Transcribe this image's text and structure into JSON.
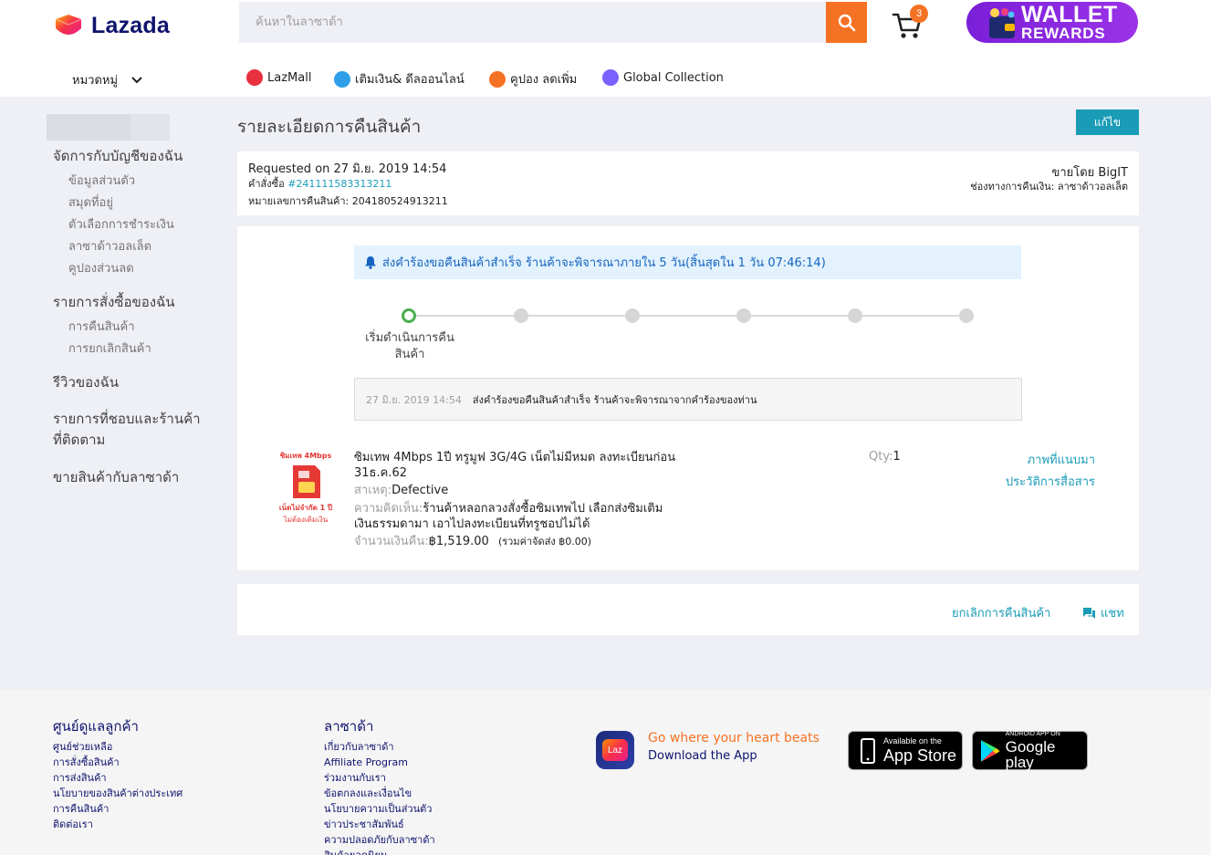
{
  "header": {
    "logo_text": "Lazada",
    "search_placeholder": "ค้นหาในลาซาด้า",
    "cart_count": "3",
    "wallet_line1": "WALLET",
    "wallet_line2": "REWARDS",
    "categories_label": "หมวดหมู่",
    "nav": [
      {
        "label": "LazMall",
        "icon": "lazmall-icon",
        "color": "#e8303f"
      },
      {
        "label": "เติมเงิน& ดีลออนไลน์",
        "icon": "topup-icon",
        "color": "#2e9fe8"
      },
      {
        "label": "คูปอง ลดเพิ่ม",
        "icon": "voucher-icon",
        "color": "#f57224"
      },
      {
        "label": "Global Collection",
        "icon": "global-icon",
        "color": "#7b61ff"
      }
    ]
  },
  "sidebar": {
    "account": {
      "title": "จัดการกับบัญชีของฉัน",
      "items": [
        "ข้อมูลส่วนตัว",
        "สมุดที่อยู่",
        "ตัวเลือกการชำระเงิน",
        "ลาซาด้าวอลเล็ต",
        "คูปองส่วนลด"
      ]
    },
    "orders": {
      "title": "รายการสั่งซื้อของฉัน",
      "items": [
        "การคืนสินค้า",
        "การยกเลิกสินค้า"
      ]
    },
    "reviews": "รีวิวของฉัน",
    "wishlist_line1": "รายการที่ชอบและร้านค้า",
    "wishlist_line2": "ที่ติดตาม",
    "sell": "ขายสินค้ากับลาซาด้า"
  },
  "main": {
    "title": "รายละเอียดการคืนสินค้า",
    "edit_label": "แก้ไข",
    "info": {
      "requested": "Requested on 27 มิ.ย. 2019 14:54",
      "order_label": "คำสั่งซื้อ ",
      "order_number": "#241111583313211",
      "return_number": "หมายเลขการคืนสินค้า: 204180524913211",
      "seller": "ขายโดย BigIT",
      "refund_channel": "ช่องทางการคืนเงิน: ลาซาด้าวอลเล็ต"
    },
    "notice": "ส่งคำร้องขอคืนสินค้าสำเร็จ ร้านค้าจะพิจารณาภายใน 5 วัน(สิ้นสุดใน 1 วัน 07:46:14)",
    "timeline_label": "เริ่มดำเนินการคืนสินค้า",
    "log": {
      "time": "27 มิ.ย. 2019 14:54",
      "text": "ส่งคำร้องขอคืนสินค้าสำเร็จ ร้านค้าจะพิจารณาจากคำร้องของท่าน"
    },
    "product": {
      "name_line1": "ซิมเทพ 4Mbps 1ปี ทรูมูฟ 3G/4G เน็ตไม่มีหมด ลงทะเบียนก่อน",
      "name_line2": "31ธ.ค.62",
      "reason_label": "สาเหตุ:",
      "reason_value": "Defective",
      "comment_label": "ความคิดเห็น:",
      "comment_line1": "ร้านค้าหลอกลวงสั่งซื้อซิมเทพไป เลือกส่งซิมเติม",
      "comment_line2": "เงินธรรมดามา เอาไปลงทะเบียนที่ทรูชอปไม่ได้",
      "amount_label": "จำนวนเงินคืน:",
      "amount_value": "฿1,519.00",
      "shipping_note": "(รวมค่าจัดส่ง ฿0.00)",
      "qty_label": "Qty:",
      "qty_value": "1",
      "image_caption_top": "ซิมเทพ 4Mbps",
      "image_caption_bottom1": "เน็ตไม่จำกัด 1 ปี",
      "image_caption_bottom2": "ไม่ต้องเติมเงิน",
      "link_photos": "ภาพที่แนบมา",
      "link_history": "ประวัติการสื่อสาร"
    },
    "actions": {
      "cancel_return": "ยกเลิกการคืนสินค้า",
      "chat": "แชท"
    }
  },
  "footer": {
    "care_title": "ศูนย์ดูแลลูกค้า",
    "care_items": [
      "ศูนย์ช่วยเหลือ",
      "การสั่งซื้อสินค้า",
      "การส่งสินค้า",
      "นโยบายของสินค้าต่างประเทศ",
      "การคืนสินค้า",
      "ติดต่อเรา"
    ],
    "lazada_title": "ลาซาด้า",
    "lazada_items": [
      "เกี่ยวกับลาซาด้า",
      "Affiliate Program",
      "ร่วมงานกับเรา",
      "ข้อตกลงและเงื่อนไข",
      "นโยบายความเป็นส่วนตัว",
      "ข่าวประชาสัมพันธ์",
      "ความปลอดภัยกับลาซาด้า",
      "สินค้ายอดนิยม"
    ],
    "app_tagline": "Go where your heart beats",
    "app_download": "Download the App",
    "app_icon_text": "Laz",
    "appstore_small": "Available on the",
    "appstore_big": "App Store",
    "gplay_small": "ANDROID APP ON",
    "gplay_big": "Google play"
  },
  "colors": {
    "accent": "#1a9cb7",
    "orange": "#f57224",
    "navy": "#0f136d",
    "success": "#4caf50"
  }
}
